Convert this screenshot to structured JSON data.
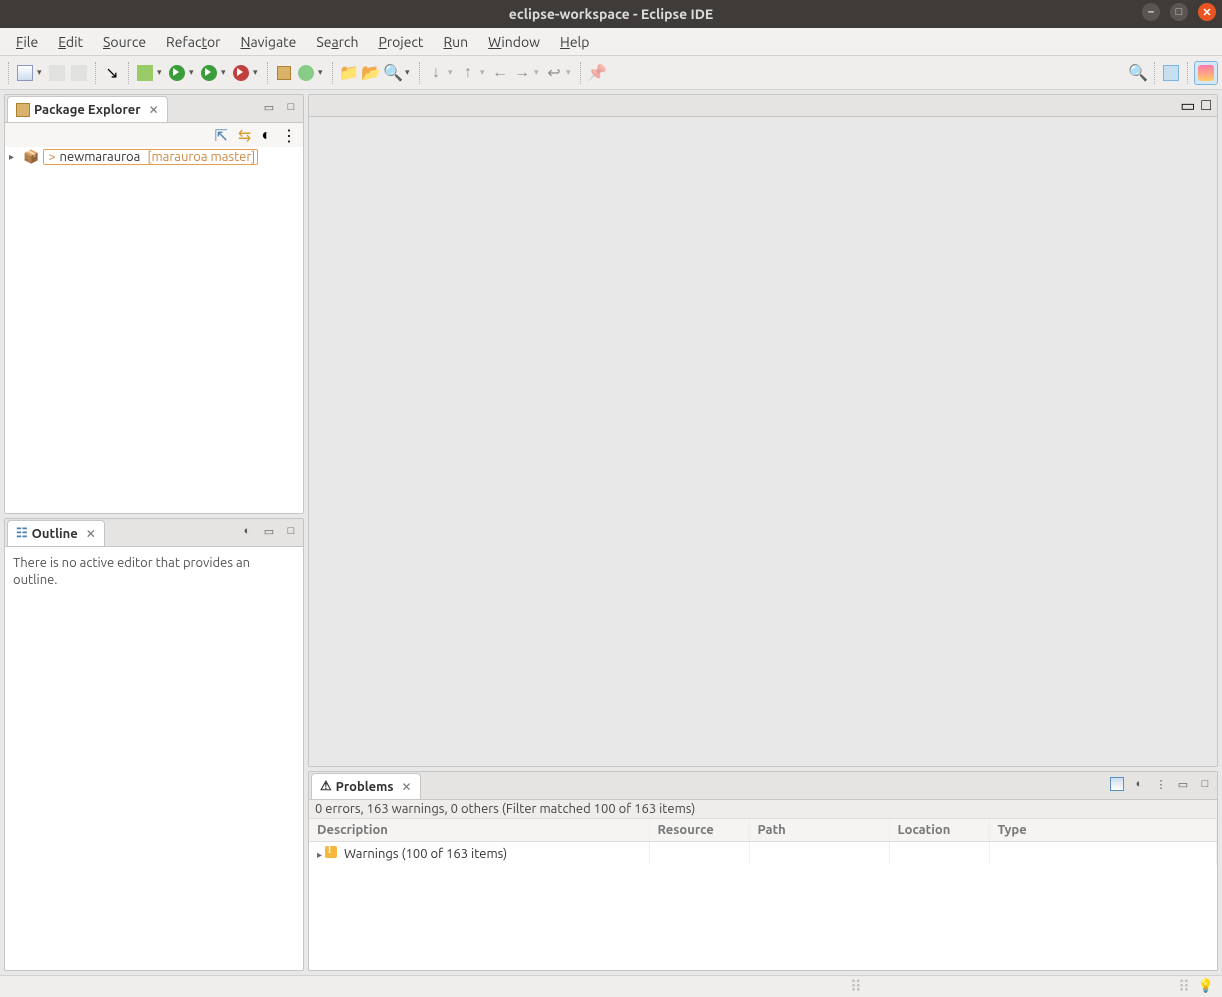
{
  "title": "eclipse-workspace - Eclipse IDE",
  "menu": [
    "File",
    "Edit",
    "Source",
    "Refactor",
    "Navigate",
    "Search",
    "Project",
    "Run",
    "Window",
    "Help"
  ],
  "package_explorer": {
    "tab_label": "Package Explorer",
    "project_marker": ">",
    "project_name": "newmarauroa",
    "project_branch": "[marauroa master]"
  },
  "outline": {
    "tab_label": "Outline",
    "empty_msg": "There is no active editor that provides an outline."
  },
  "problems": {
    "tab_label": "Problems",
    "summary": "0 errors, 163 warnings, 0 others (Filter matched 100 of 163 items)",
    "columns": [
      "Description",
      "Resource",
      "Path",
      "Location",
      "Type"
    ],
    "warnings_row": "Warnings (100 of 163 items)"
  }
}
